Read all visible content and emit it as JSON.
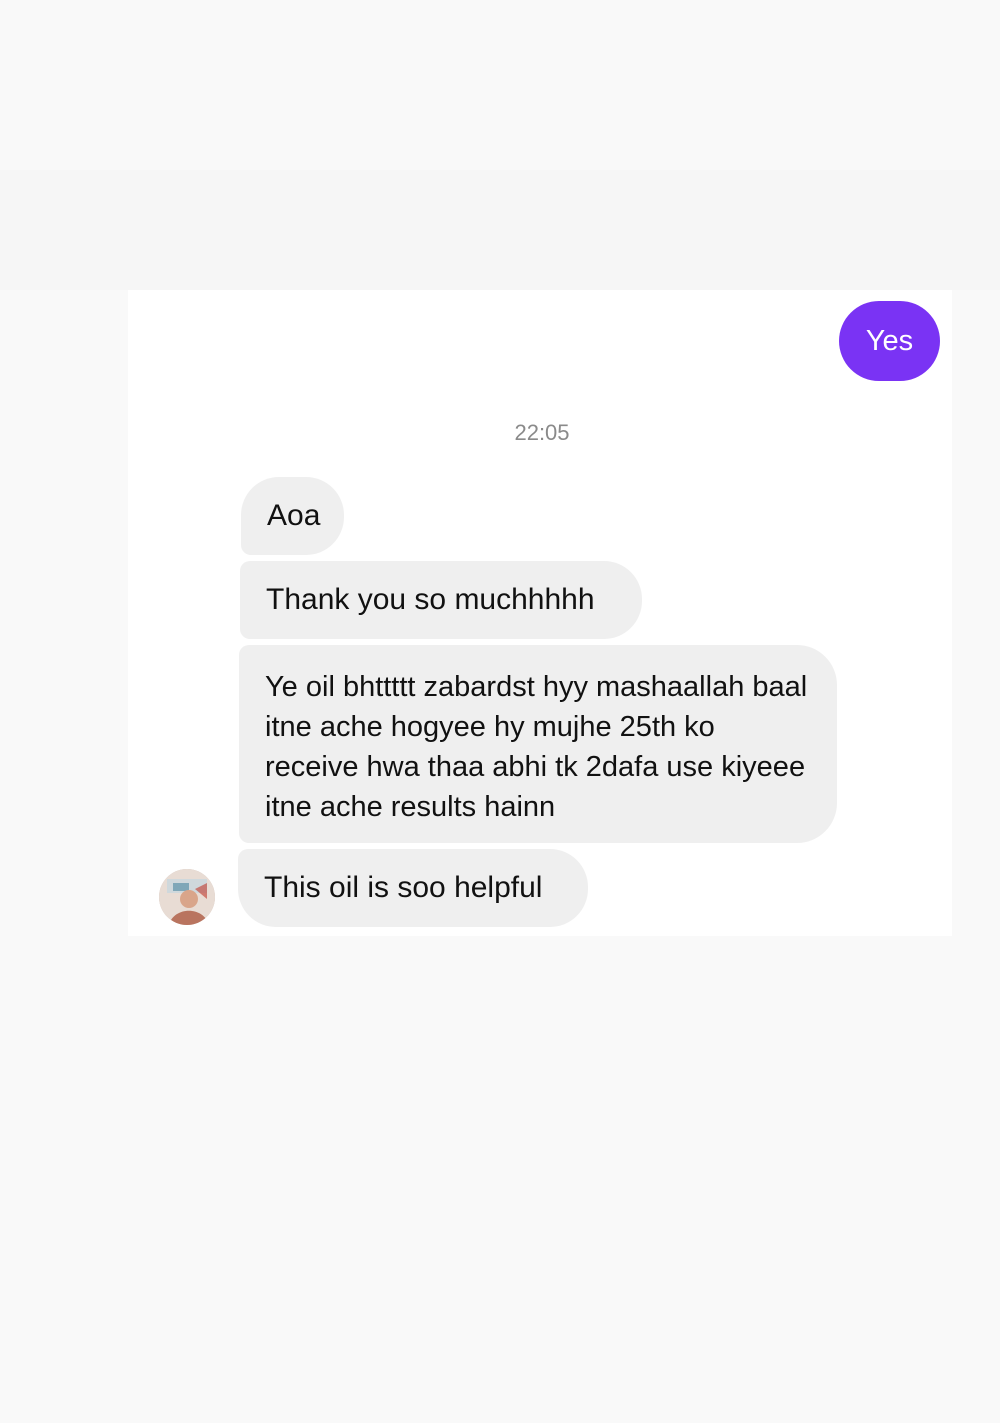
{
  "conversation": {
    "outgoing": [
      {
        "text": "Yes"
      }
    ],
    "timestamp": "22:05",
    "incoming": [
      {
        "text": "Aoa"
      },
      {
        "text": "Thank you so muchhhhh"
      },
      {
        "text": "Ye oil bhttttt zabardst hyy mashaallah baal itne ache hogyee hy mujhe 25th ko receive hwa thaa abhi tk 2dafa use kiyeee itne ache results hainn"
      },
      {
        "text": "This oil is soo helpful"
      }
    ]
  },
  "colors": {
    "outgoing_bubble": "#7a33f4",
    "incoming_bubble": "#efefef",
    "timestamp_text": "#8a8a8a",
    "page_background": "#f9f9f9"
  },
  "icons": {
    "sender_avatar": "avatar"
  }
}
